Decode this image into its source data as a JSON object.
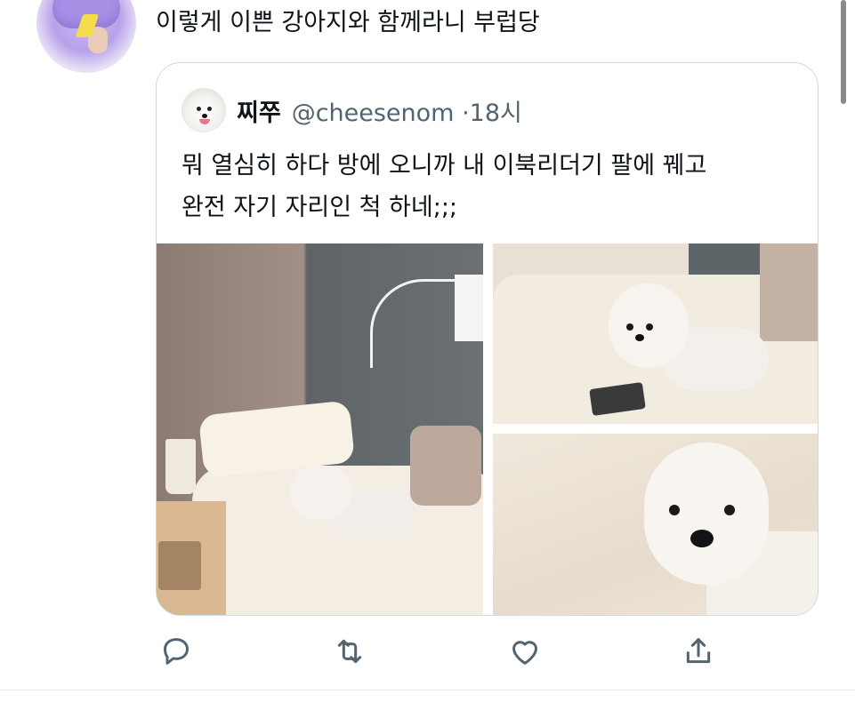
{
  "tweet": {
    "text": "이렇게 이쁜 강아지와 함께라니 부럽당",
    "avatar_icon": "purple-plush-avatar"
  },
  "quote": {
    "name": "찌쭈",
    "handle": "@cheesenom",
    "separator": "·",
    "time": "18시",
    "body_line1": "뭐 열심히 하다 방에 오니까 내 이북리더기 팔에 꿰고",
    "body_line2": "완전 자기 자리인 척 하네;;;",
    "photos": [
      "photo-1",
      "photo-2",
      "photo-3"
    ]
  },
  "actions": {
    "reply_icon": "reply-icon",
    "retweet_icon": "retweet-icon",
    "like_icon": "heart-icon",
    "share_icon": "share-icon"
  },
  "colors": {
    "text": "#0f1419",
    "secondary": "#536471",
    "border": "#cfd9de",
    "icon": "#536471"
  }
}
